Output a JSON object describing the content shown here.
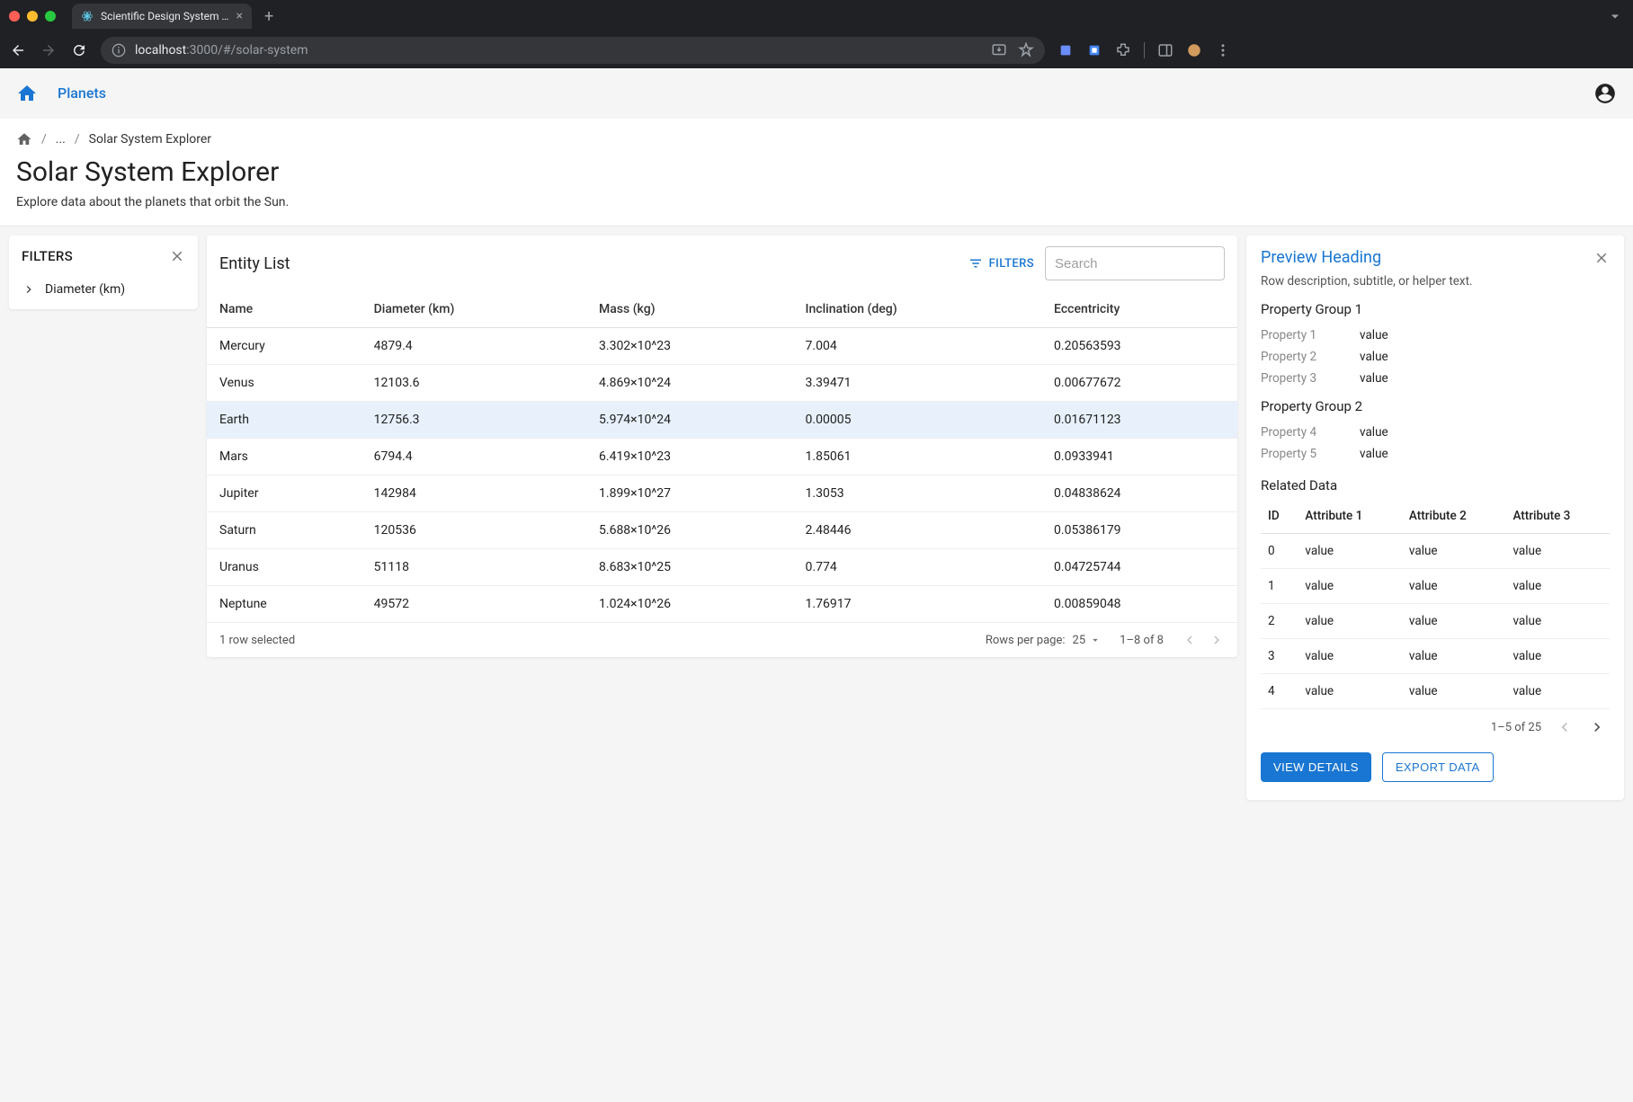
{
  "browser": {
    "tab_title": "Scientific Design System Tem",
    "url_host": "localhost",
    "url_port_path": ":3000/#/solar-system"
  },
  "header": {
    "nav_link": "Planets"
  },
  "breadcrumbs": {
    "ellipsis": "...",
    "current": "Solar System Explorer"
  },
  "page": {
    "title": "Solar System Explorer",
    "subtitle": "Explore data about the planets that orbit the Sun."
  },
  "filters_panel": {
    "title": "FILTERS",
    "items": [
      {
        "label": "Diameter (km)"
      }
    ]
  },
  "entity": {
    "title": "Entity List",
    "filters_button": "FILTERS",
    "search_placeholder": "Search",
    "columns": [
      "Name",
      "Diameter (km)",
      "Mass (kg)",
      "Inclination (deg)",
      "Eccentricity"
    ],
    "rows": [
      {
        "name": "Mercury",
        "diameter": "4879.4",
        "mass": "3.302×10^23",
        "inclination": "7.004",
        "ecc": "0.20563593",
        "selected": false
      },
      {
        "name": "Venus",
        "diameter": "12103.6",
        "mass": "4.869×10^24",
        "inclination": "3.39471",
        "ecc": "0.00677672",
        "selected": false
      },
      {
        "name": "Earth",
        "diameter": "12756.3",
        "mass": "5.974×10^24",
        "inclination": "0.00005",
        "ecc": "0.01671123",
        "selected": true
      },
      {
        "name": "Mars",
        "diameter": "6794.4",
        "mass": "6.419×10^23",
        "inclination": "1.85061",
        "ecc": "0.0933941",
        "selected": false
      },
      {
        "name": "Jupiter",
        "diameter": "142984",
        "mass": "1.899×10^27",
        "inclination": "1.3053",
        "ecc": "0.04838624",
        "selected": false
      },
      {
        "name": "Saturn",
        "diameter": "120536",
        "mass": "5.688×10^26",
        "inclination": "2.48446",
        "ecc": "0.05386179",
        "selected": false
      },
      {
        "name": "Uranus",
        "diameter": "51118",
        "mass": "8.683×10^25",
        "inclination": "0.774",
        "ecc": "0.04725744",
        "selected": false
      },
      {
        "name": "Neptune",
        "diameter": "49572",
        "mass": "1.024×10^26",
        "inclination": "1.76917",
        "ecc": "0.00859048",
        "selected": false
      }
    ],
    "footer": {
      "selected_text": "1 row selected",
      "rows_per_page_label": "Rows per page:",
      "rows_per_page_value": "25",
      "range": "1–8 of 8"
    }
  },
  "preview": {
    "heading": "Preview Heading",
    "subtitle": "Row description, subtitle, or helper text.",
    "groups": [
      {
        "title": "Property Group 1",
        "props": [
          {
            "key": "Property 1",
            "val": "value"
          },
          {
            "key": "Property 2",
            "val": "value"
          },
          {
            "key": "Property 3",
            "val": "value"
          }
        ]
      },
      {
        "title": "Property Group 2",
        "props": [
          {
            "key": "Property 4",
            "val": "value"
          },
          {
            "key": "Property 5",
            "val": "value"
          }
        ]
      }
    ],
    "related": {
      "title": "Related Data",
      "columns": [
        "ID",
        "Attribute 1",
        "Attribute 2",
        "Attribute 3"
      ],
      "rows": [
        {
          "id": "0",
          "a1": "value",
          "a2": "value",
          "a3": "value"
        },
        {
          "id": "1",
          "a1": "value",
          "a2": "value",
          "a3": "value"
        },
        {
          "id": "2",
          "a1": "value",
          "a2": "value",
          "a3": "value"
        },
        {
          "id": "3",
          "a1": "value",
          "a2": "value",
          "a3": "value"
        },
        {
          "id": "4",
          "a1": "value",
          "a2": "value",
          "a3": "value"
        }
      ],
      "range": "1–5 of 25"
    },
    "buttons": {
      "view_details": "VIEW DETAILS",
      "export_data": "EXPORT DATA"
    }
  }
}
